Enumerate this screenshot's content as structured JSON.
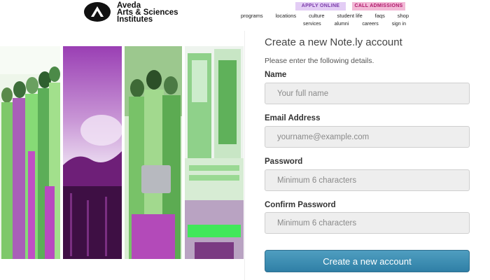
{
  "brand": {
    "logo_icon": "aveda-a-icon",
    "name_lines": [
      "Aveda",
      "Arts & Sciences",
      "Institutes"
    ]
  },
  "header": {
    "apply_online": "APPLY ONLINE",
    "call_admissions": "CALL ADMISSIONS",
    "nav_primary": [
      "programs",
      "locations",
      "culture",
      "student life",
      "faqs",
      "shop"
    ],
    "nav_secondary": [
      "services",
      "alumni",
      "careers",
      "sign in"
    ]
  },
  "form": {
    "title": "Create a new Note.ly account",
    "subtitle": "Please enter the following details.",
    "name_label": "Name",
    "name_placeholder": "Your full name",
    "email_label": "Email Address",
    "email_placeholder": "yourname@example.com",
    "password_label": "Password",
    "password_placeholder": "Minimum 6 characters",
    "confirm_label": "Confirm Password",
    "confirm_placeholder": "Minimum 6 characters",
    "submit_label": "Create a new account"
  },
  "colors": {
    "apply_bg": "#e3cdf5",
    "call_bg": "#f2b9d6",
    "button": "#3b8db3",
    "photo_green": "#7ed87a",
    "photo_purple": "#9b2fa8"
  }
}
